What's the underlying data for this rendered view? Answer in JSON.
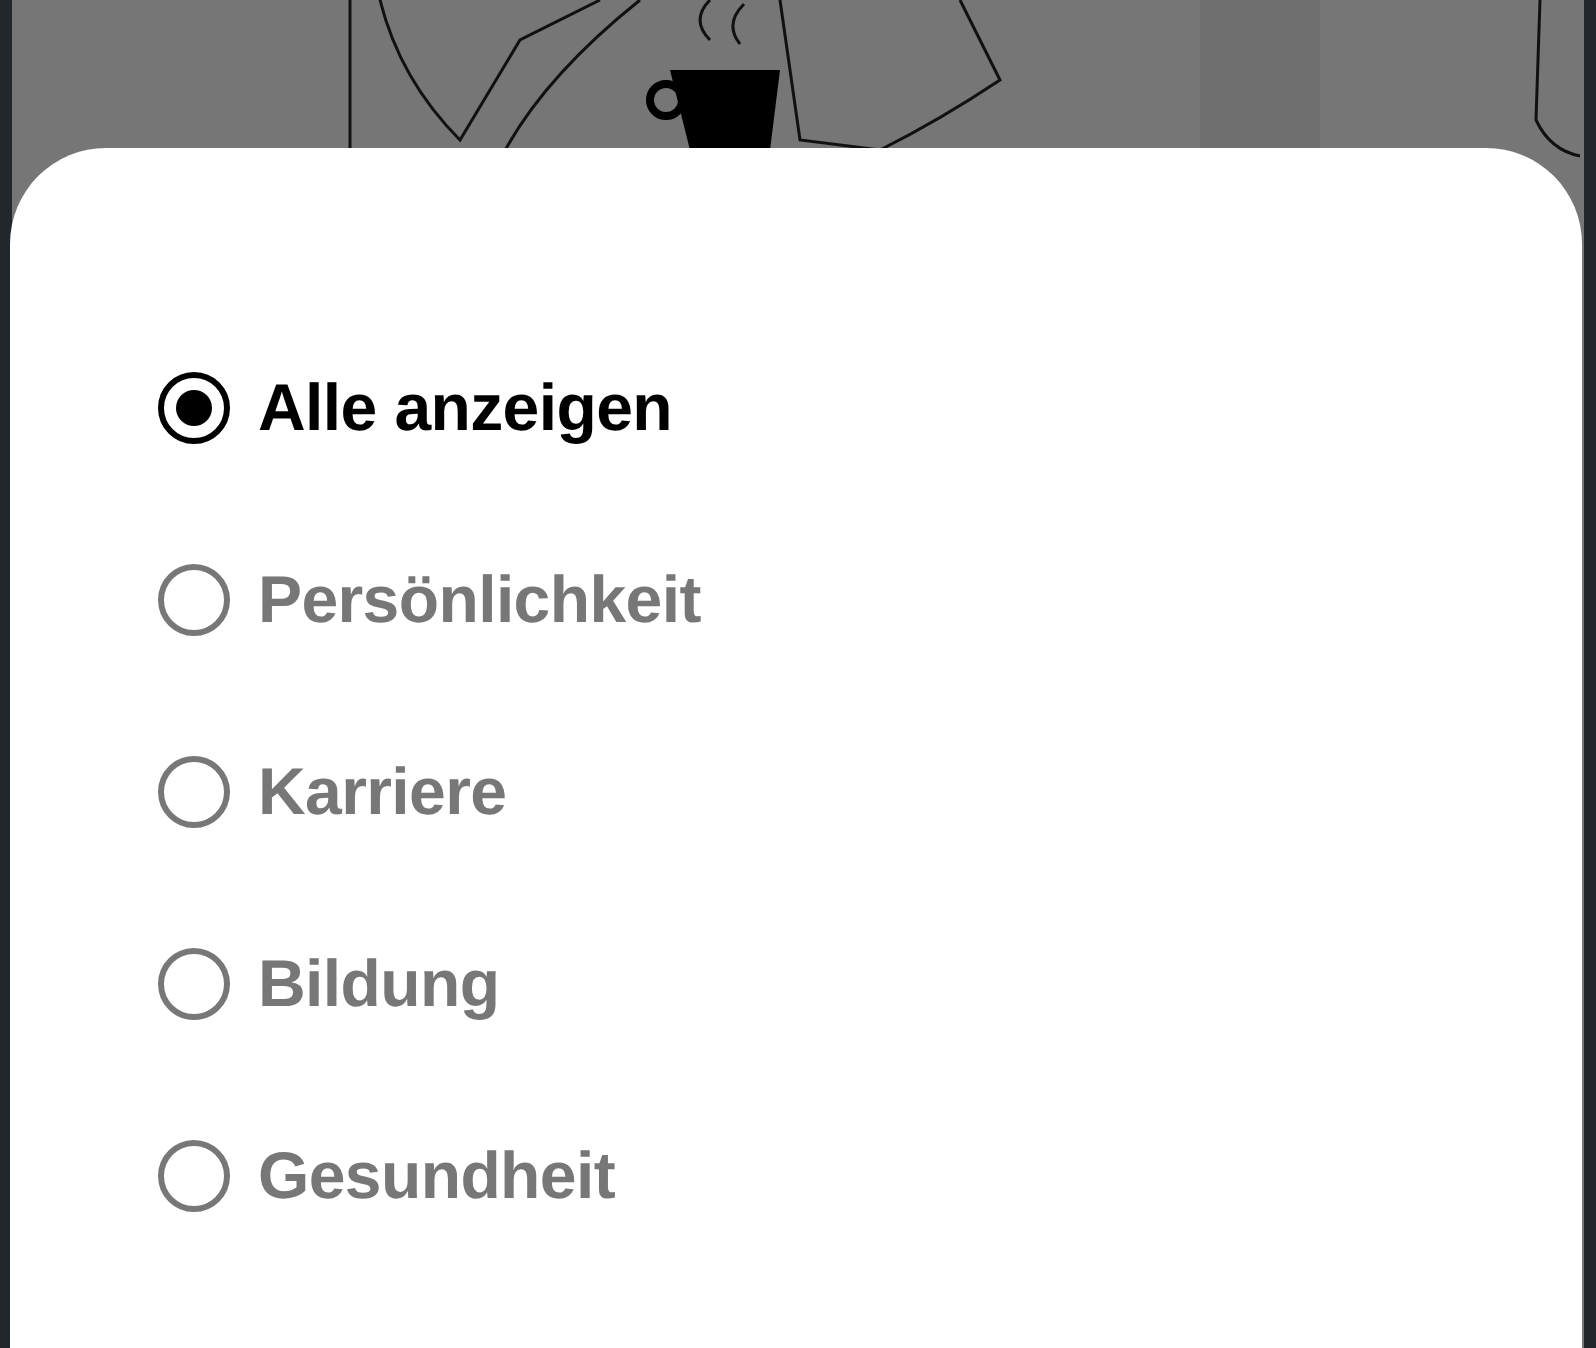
{
  "filter_options": [
    {
      "label": "Alle anzeigen",
      "selected": true
    },
    {
      "label": "Persönlichkeit",
      "selected": false
    },
    {
      "label": "Karriere",
      "selected": false
    },
    {
      "label": "Bildung",
      "selected": false
    },
    {
      "label": "Gesundheit",
      "selected": false
    }
  ]
}
